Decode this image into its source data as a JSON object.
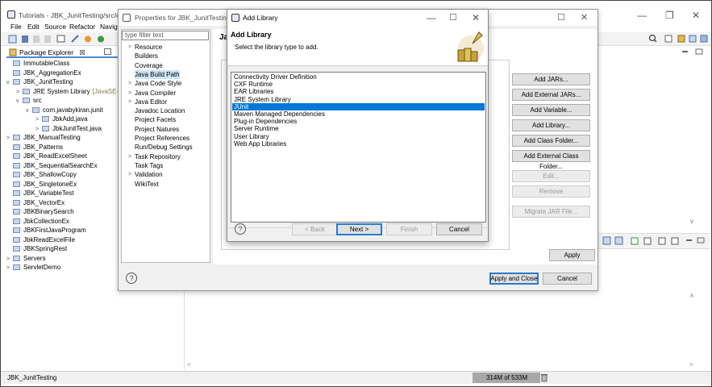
{
  "main_window": {
    "title": "Tutorials - JBK_JunitTesting/src/com/",
    "menu": [
      "File",
      "Edit",
      "Source",
      "Refactor",
      "Naviga"
    ],
    "controls": {
      "minimize": "—",
      "restore": "❐",
      "close": "✕"
    }
  },
  "package_explorer": {
    "tab_label": "Package Explorer",
    "tab_close": "☒",
    "items": [
      {
        "label": "ImmutableClass",
        "indent": 0,
        "twisty": ""
      },
      {
        "label": "JBK_AggregationEx",
        "indent": 0,
        "twisty": ""
      },
      {
        "label": "JBK_JunitTesting",
        "indent": 0,
        "twisty": "v"
      },
      {
        "label": "JRE System Library",
        "suffix": "[JavaSE-1.8",
        "indent": 1,
        "twisty": ">"
      },
      {
        "label": "src",
        "indent": 1,
        "twisty": "v"
      },
      {
        "label": "com.javabykiran.junit",
        "indent": 2,
        "twisty": "v"
      },
      {
        "label": "JbkAdd.java",
        "indent": 3,
        "twisty": ">"
      },
      {
        "label": "JbkJunitTest.java",
        "indent": 3,
        "twisty": ">"
      },
      {
        "label": "JBK_ManualTesting",
        "indent": 0,
        "twisty": ">"
      },
      {
        "label": "JBK_Patterns",
        "indent": 0,
        "twisty": ""
      },
      {
        "label": "JBK_ReadExcelSheet",
        "indent": 0,
        "twisty": ""
      },
      {
        "label": "JBK_SequentialSearchEx",
        "indent": 0,
        "twisty": ""
      },
      {
        "label": "JBK_ShallowCopy",
        "indent": 0,
        "twisty": ""
      },
      {
        "label": "JBK_SingletoneEx",
        "indent": 0,
        "twisty": ""
      },
      {
        "label": "JBK_VariableTest",
        "indent": 0,
        "twisty": ""
      },
      {
        "label": "JBK_VectorEx",
        "indent": 0,
        "twisty": ""
      },
      {
        "label": "JBKBinarySearch",
        "indent": 0,
        "twisty": ""
      },
      {
        "label": "JbkCollectionEx",
        "indent": 0,
        "twisty": ""
      },
      {
        "label": "JBKFirstJavaProgram",
        "indent": 0,
        "twisty": ""
      },
      {
        "label": "JbkReadExcelFile",
        "indent": 0,
        "twisty": ""
      },
      {
        "label": "JBKSpringRest",
        "indent": 0,
        "twisty": ""
      },
      {
        "label": "Servers",
        "indent": 0,
        "twisty": ">"
      },
      {
        "label": "ServletDemo",
        "indent": 0,
        "twisty": ">"
      }
    ]
  },
  "status_bar": {
    "selection": "JBK_JunitTesting",
    "heap": "314M of 533M"
  },
  "properties_dialog": {
    "title": "Properties for JBK_JunitTesting",
    "filter_placeholder": "type filter text",
    "page_title_partial": "Ja",
    "categories": [
      {
        "label": "Resource",
        "arrow": ">"
      },
      {
        "label": "Builders",
        "arrow": ""
      },
      {
        "label": "Coverage",
        "arrow": ""
      },
      {
        "label": "Java Build Path",
        "arrow": "",
        "selected": true
      },
      {
        "label": "Java Code Style",
        "arrow": ">"
      },
      {
        "label": "Java Compiler",
        "arrow": ">"
      },
      {
        "label": "Java Editor",
        "arrow": ">"
      },
      {
        "label": "Javadoc Location",
        "arrow": ""
      },
      {
        "label": "Project Facets",
        "arrow": ""
      },
      {
        "label": "Project Natures",
        "arrow": ""
      },
      {
        "label": "Project References",
        "arrow": ""
      },
      {
        "label": "Run/Debug Settings",
        "arrow": ""
      },
      {
        "label": "Task Repository",
        "arrow": ">"
      },
      {
        "label": "Task Tags",
        "arrow": ""
      },
      {
        "label": "Validation",
        "arrow": ">"
      },
      {
        "label": "WikiText",
        "arrow": ""
      }
    ],
    "side_buttons": {
      "add_jars": "Add JARs...",
      "add_external_jars": "Add External JARs...",
      "add_variable": "Add Variable...",
      "add_library": "Add Library...",
      "add_class_folder": "Add Class Folder...",
      "add_external_class_folder": "Add External Class Folder...",
      "edit": "Edit...",
      "remove": "Remove",
      "migrate_jar": "Migrate JAR File..."
    },
    "apply": "Apply",
    "apply_and_close": "Apply and Close",
    "cancel": "Cancel",
    "help": "?"
  },
  "add_library_dialog": {
    "title": "Add Library",
    "heading": "Add Library",
    "subtitle": "Select the library type to add.",
    "libraries": [
      "Connectivity Driver Definition",
      "CXF Runtime",
      "EAR Libraries",
      "JRE System Library",
      "JUnit",
      "Maven Managed Dependencies",
      "Plug-in Dependencies",
      "Server Runtime",
      "User Library",
      "Web App Libraries"
    ],
    "selected_index": 4,
    "buttons": {
      "back": "< Back",
      "next": "Next >",
      "finish": "Finish",
      "cancel": "Cancel"
    },
    "help": "?"
  }
}
